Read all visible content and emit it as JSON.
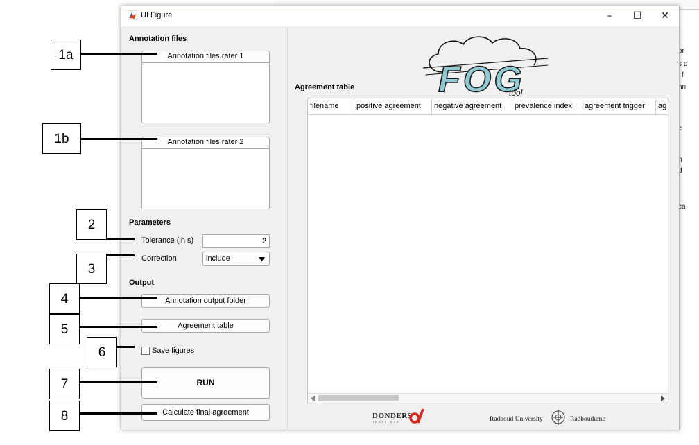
{
  "window": {
    "title": "UI Figure",
    "minimize_glyph": "–",
    "maximize_glyph": "☐",
    "close_glyph": "✕"
  },
  "annotation_files": {
    "heading": "Annotation files",
    "rater1_button": "Annotation files rater 1",
    "rater2_button": "Annotation files rater 2"
  },
  "parameters": {
    "heading": "Parameters",
    "tolerance_label": "Tolerance (in s)",
    "tolerance_value": "2",
    "correction_label": "Correction",
    "correction_value": "include"
  },
  "output": {
    "heading": "Output",
    "annotation_folder_button": "Annotation output folder",
    "agreement_table_button": "Agreement table",
    "save_figures_label": "Save figures",
    "save_figures_checked": false,
    "run_button": "RUN",
    "calc_final_button": "Calculate final agreement"
  },
  "agreement": {
    "heading": "Agreement table",
    "columns": [
      "filename",
      "positive agreement",
      "negative agreement",
      "prevalence index",
      "agreement trigger",
      "ag"
    ]
  },
  "logos": {
    "fog_main": "FOG",
    "fog_sub": "tool",
    "donders": "DONDERS",
    "donders_sub": "INSTITUTE",
    "radboud_university": "Radboud University",
    "radboudumc": "Radboudumc"
  },
  "callouts": [
    "1a",
    "1b",
    "2",
    "3",
    "4",
    "5",
    "6",
    "7",
    "8"
  ],
  "background_window_text": [
    "or",
    "s p",
    "l f",
    "nn",
    "c",
    "n",
    "d",
    "ca"
  ],
  "colors": {
    "window_bg": "#f0f0f0",
    "matlab_icon": "#d9541e",
    "donders_red": "#d7261e",
    "fog_teal": "#2e7f8c"
  }
}
